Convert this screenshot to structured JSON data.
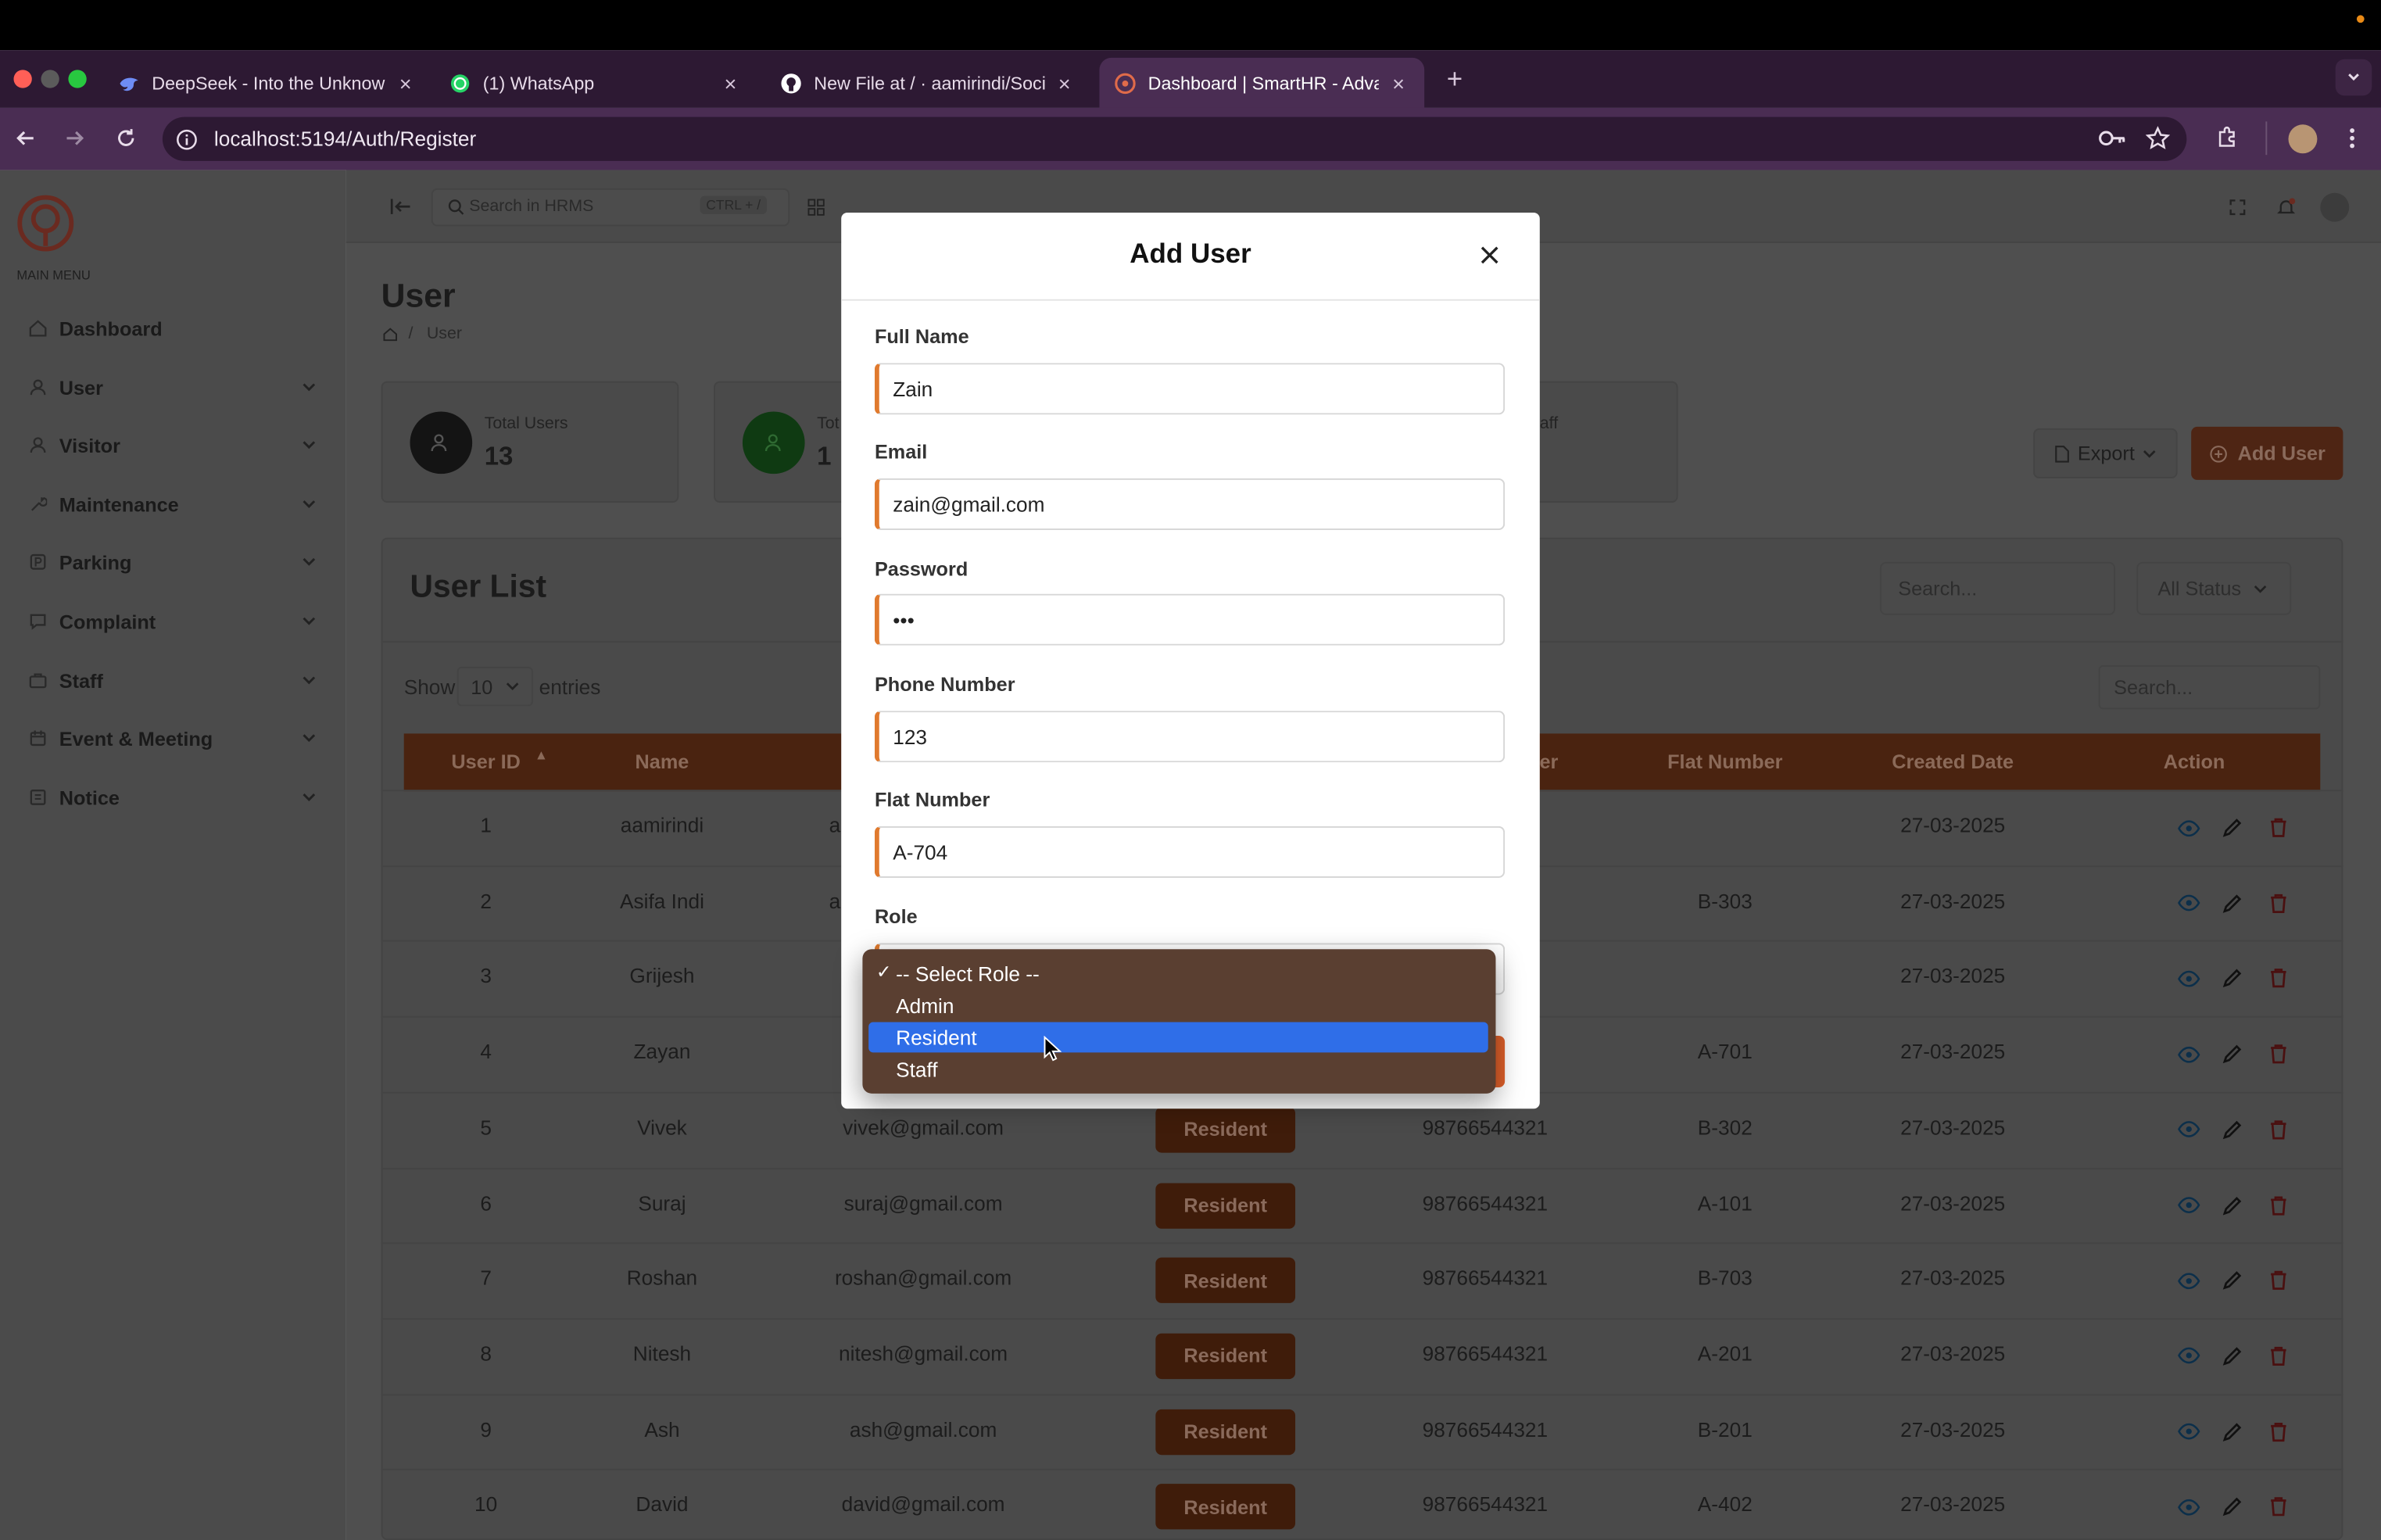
{
  "browser": {
    "tabs": [
      {
        "title": "DeepSeek - Into the Unknown",
        "icon": "deepseek-icon"
      },
      {
        "title": "(1) WhatsApp",
        "icon": "whatsapp-icon"
      },
      {
        "title": "New File at / · aamirindi/Socie",
        "icon": "github-icon"
      },
      {
        "title": "Dashboard | SmartHR - Advan",
        "icon": "smarthr-icon",
        "active": true
      }
    ],
    "url": "localhost:5194/Auth/Register"
  },
  "sidebar": {
    "section_label": "MAIN MENU",
    "items": [
      {
        "label": "Dashboard",
        "icon": "dashboard-icon"
      },
      {
        "label": "User",
        "icon": "user-icon"
      },
      {
        "label": "Visitor",
        "icon": "visitor-icon"
      },
      {
        "label": "Maintenance",
        "icon": "wrench-icon"
      },
      {
        "label": "Parking",
        "icon": "parking-icon"
      },
      {
        "label": "Complaint",
        "icon": "chat-icon"
      },
      {
        "label": "Staff",
        "icon": "briefcase-icon"
      },
      {
        "label": "Event & Meeting",
        "icon": "calendar-icon"
      },
      {
        "label": "Notice",
        "icon": "notice-icon"
      }
    ]
  },
  "header": {
    "search_placeholder": "Search in HRMS",
    "search_shortcut": "CTRL + /"
  },
  "page": {
    "title": "User",
    "breadcrumb": "User",
    "stats": [
      {
        "label": "Total Users",
        "value": "13"
      },
      {
        "label": "Tot",
        "value": "1"
      },
      {
        "label": "aff",
        "value": ""
      }
    ],
    "export_label": "Export",
    "add_user_label": "Add User"
  },
  "user_list": {
    "title": "User List",
    "search_placeholder": "Search...",
    "status_filter": "All Status",
    "show_label": "Show",
    "entries_value": "10",
    "entries_label": "entries",
    "table_search_placeholder": "Search...",
    "columns": [
      "User ID",
      "Name",
      "",
      "",
      "er",
      "Flat Number",
      "Created Date",
      "Action"
    ],
    "rows": [
      {
        "id": "1",
        "name": "aamirindi",
        "email": "a",
        "role": "",
        "phone": "",
        "flat": "",
        "date": "27-03-2025"
      },
      {
        "id": "2",
        "name": "Asifa Indi",
        "email": "a",
        "role": "",
        "phone": "",
        "flat": "B-303",
        "date": "27-03-2025"
      },
      {
        "id": "3",
        "name": "Grijesh",
        "email": "",
        "role": "",
        "phone": "",
        "flat": "",
        "date": "27-03-2025"
      },
      {
        "id": "4",
        "name": "Zayan",
        "email": "",
        "role": "",
        "phone": "",
        "flat": "A-701",
        "date": "27-03-2025"
      },
      {
        "id": "5",
        "name": "Vivek",
        "email": "vivek@gmail.com",
        "role": "Resident",
        "phone": "98766544321",
        "flat": "B-302",
        "date": "27-03-2025"
      },
      {
        "id": "6",
        "name": "Suraj",
        "email": "suraj@gmail.com",
        "role": "Resident",
        "phone": "98766544321",
        "flat": "A-101",
        "date": "27-03-2025"
      },
      {
        "id": "7",
        "name": "Roshan",
        "email": "roshan@gmail.com",
        "role": "Resident",
        "phone": "98766544321",
        "flat": "B-703",
        "date": "27-03-2025"
      },
      {
        "id": "8",
        "name": "Nitesh",
        "email": "nitesh@gmail.com",
        "role": "Resident",
        "phone": "98766544321",
        "flat": "A-201",
        "date": "27-03-2025"
      },
      {
        "id": "9",
        "name": "Ash",
        "email": "ash@gmail.com",
        "role": "Resident",
        "phone": "98766544321",
        "flat": "B-201",
        "date": "27-03-2025"
      },
      {
        "id": "10",
        "name": "David",
        "email": "david@gmail.com",
        "role": "Resident",
        "phone": "98766544321",
        "flat": "A-402",
        "date": "27-03-2025"
      }
    ]
  },
  "modal": {
    "title": "Add User",
    "fields": {
      "full_name": {
        "label": "Full Name",
        "value": "Zain"
      },
      "email": {
        "label": "Email",
        "value": "zain@gmail.com"
      },
      "password": {
        "label": "Password",
        "value": "•••"
      },
      "phone": {
        "label": "Phone Number",
        "value": "123"
      },
      "flat": {
        "label": "Flat Number",
        "value": "A-704"
      },
      "role": {
        "label": "Role"
      }
    },
    "role_options": [
      {
        "label": "-- Select Role --",
        "checked": true
      },
      {
        "label": "Admin"
      },
      {
        "label": "Resident",
        "highlighted": true
      },
      {
        "label": "Staff"
      }
    ]
  },
  "colors": {
    "accent": "#e07a2e",
    "table_header": "#4a2310",
    "highlight": "#2f6ee8"
  }
}
